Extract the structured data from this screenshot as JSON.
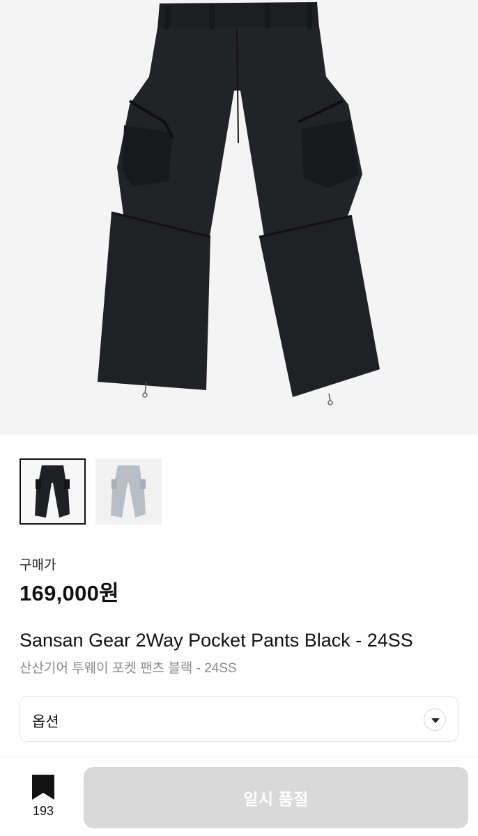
{
  "product": {
    "price_label": "구매가",
    "price": "169,000원",
    "title_en": "Sansan Gear 2Way Pocket Pants Black - 24SS",
    "title_ko": "산산기어 투웨이 포켓 팬츠 블랙 - 24SS",
    "main_image_icon": "black-cargo-pants-image",
    "thumbnails": [
      {
        "icon": "black-pants-thumbnail",
        "selected": true
      },
      {
        "icon": "grey-pants-thumbnail",
        "selected": false
      }
    ]
  },
  "option": {
    "label": "옵션",
    "icon": "chevron-down-icon"
  },
  "bottom_bar": {
    "bookmark_icon": "bookmark-icon",
    "bookmark_count": "193",
    "action_label": "일시 품절"
  },
  "colors": {
    "hero_bg": "#f4f4f4",
    "pants_black": "#1f2024",
    "pants_grey": "#b9bec6",
    "button_disabled": "#d9d9d9"
  }
}
